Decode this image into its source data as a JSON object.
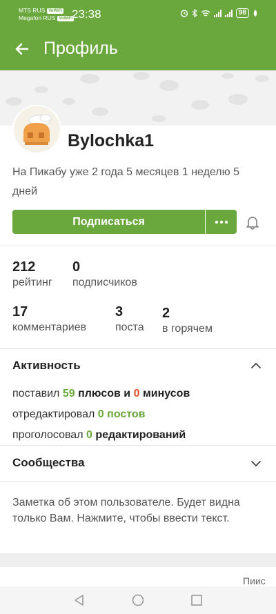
{
  "statusbar": {
    "carrier1": "MTS RUS",
    "carrier2": "Megafon RUS",
    "volte": "VoWiFi",
    "time": "23:38",
    "battery": "98"
  },
  "appbar": {
    "title": "Профиль"
  },
  "profile": {
    "username": "Bylochka1",
    "since": "На Пикабу уже 2 года 5 месяцев 1 неделю 5 дней",
    "subscribe_label": "Подписаться",
    "more_label": "•••"
  },
  "stats": {
    "rating": {
      "value": "212",
      "label": "рейтинг"
    },
    "subscribers": {
      "value": "0",
      "label": "подписчиков"
    },
    "comments": {
      "value": "17",
      "label": "комментариев"
    },
    "posts": {
      "value": "3",
      "label": "поста"
    },
    "hot": {
      "value": "2",
      "label": "в горячем"
    }
  },
  "activity": {
    "title": "Активность",
    "line1": {
      "prefix": "поставил ",
      "pluses": "59",
      "mid": " плюсов и ",
      "minuses": "0",
      "suffix": " минусов"
    },
    "line2": {
      "prefix": "отредактировал ",
      "count": "0",
      "suffix": " постов"
    },
    "line3": {
      "prefix": "проголосовал ",
      "count": "0",
      "suffix": " редактирований"
    }
  },
  "communities": {
    "title": "Сообщества"
  },
  "note": {
    "placeholder": "Заметка об этом пользователе. Будет видна только Вам. Нажмите, чтобы ввести текст."
  },
  "tabs_peek": {
    "right_label": "Пиис"
  },
  "colors": {
    "brand": "#6aa83d",
    "minus": "#e0502b"
  }
}
